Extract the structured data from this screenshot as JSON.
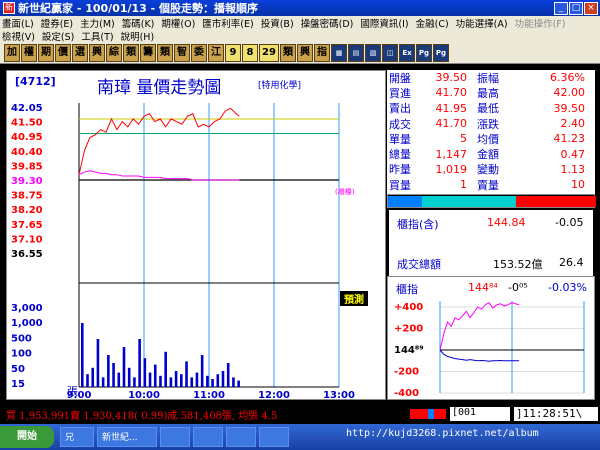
{
  "window": {
    "title": "新世紀贏家 - 100/01/13 - 個股走勢：播報順序",
    "controls": [
      "_",
      "□",
      "×"
    ]
  },
  "menu": {
    "row1": [
      "畫面(L)",
      "證券(E)",
      "主力(M)",
      "籌碼(K)",
      "期權(O)",
      "匯市利率(E)",
      "投資(B)",
      "操盤密碼(D)",
      "國際資訊(I)",
      "金融(C)",
      "功能選擇(A)",
      "功能操作(F)"
    ],
    "row2": [
      "檢視(V)",
      "設定(S)",
      "工具(T)",
      "說明(H)"
    ]
  },
  "toolbar": {
    "buttons": [
      "加",
      "權",
      "期",
      "價",
      "選",
      "興",
      "綜",
      "類",
      "籌",
      "類",
      "智",
      "委",
      "江",
      "9",
      "8",
      "29",
      "類",
      "興",
      "指"
    ]
  },
  "stock": {
    "code": "[4712]",
    "name": "南璋  量價走勢圖",
    "tag": "[特用化學]",
    "zhi_label": "(櫃檯)",
    "yumei_label": "預測",
    "zhang_label": "張"
  },
  "price_axis": [
    "42.05",
    "41.50",
    "40.95",
    "40.40",
    "39.85",
    "39.30",
    "38.75",
    "38.20",
    "37.65",
    "37.10",
    "36.55"
  ],
  "volume_axis": [
    "3,000",
    "1,000",
    "500",
    "100",
    "50",
    "15"
  ],
  "time_axis": [
    "9:00",
    "10:00",
    "11:00",
    "12:00",
    "13:00"
  ],
  "quote": {
    "rows": [
      {
        "l1": "開盤",
        "v1": "39.50",
        "c1": "#ff0000",
        "l2": "振幅",
        "v2": "6.36%",
        "c2": "#ff0000"
      },
      {
        "l1": "買進",
        "v1": "41.70",
        "c1": "#ff0000",
        "l2": "最高",
        "v2": "42.00",
        "c2": "#ff0000"
      },
      {
        "l1": "賣出",
        "v1": "41.95",
        "c1": "#ff0000",
        "l2": "最低",
        "v2": "39.50",
        "c2": "#ff0000"
      },
      {
        "l1": "成交",
        "v1": "41.70",
        "c1": "#ff0000",
        "l2": "漲跌",
        "v2": "2.40",
        "c2": "#ff0000"
      },
      {
        "l1": "單量",
        "v1": "5",
        "c1": "#ff0000",
        "l2": "均價",
        "v2": "41.23",
        "c2": "#ff0000"
      },
      {
        "l1": "總量",
        "v1": "1,147",
        "c1": "#ff0000",
        "l2": "金額",
        "v2": "0.47",
        "c2": "#ff0000"
      },
      {
        "l1": "昨量",
        "v1": "1,019",
        "c1": "#ff0000",
        "l2": "變動",
        "v2": "1.13",
        "c2": "#ff0000"
      },
      {
        "l1": "買量",
        "v1": "1",
        "c1": "#ff0000",
        "l2": "賣量",
        "v2": "10",
        "c2": "#ff0000"
      }
    ]
  },
  "index": {
    "label": "櫃指(含)",
    "value": "144.84",
    "change": "-0.05",
    "vol_label": "成交總額",
    "vol_value": "153.52億",
    "vol_change": "26.4"
  },
  "mini": {
    "label": "櫃指",
    "value": "144⁸⁴",
    "change": "-0⁰⁵",
    "pct": "-0.03%",
    "axis": [
      "+400",
      "+200",
      "144⁸⁹",
      "-200",
      "-400"
    ]
  },
  "status": {
    "summary": "買 1,953,991賣 1,930,418( 0.99)成 581,408張, 均張 4.5",
    "code": "[001",
    "clock": "]11:28:51\\"
  },
  "taskbar": {
    "start": "開始",
    "tasks": [
      "兄",
      "新世紀...",
      "",
      "",
      "",
      "",
      ""
    ],
    "url": "http://kujd3268.pixnet.net/album"
  },
  "colors": {
    "price_line": "#ff0000",
    "avg_line": "#ff00ff",
    "volume": "#0000cc",
    "grid_v": "#3399ff",
    "ref_line": "#00aa66"
  },
  "chart_data": [
    {
      "type": "line",
      "x_time": [
        "9:00",
        "9:05",
        "9:10",
        "9:15",
        "9:20",
        "9:25",
        "9:30",
        "9:35",
        "9:40",
        "9:45",
        "9:50",
        "9:55",
        "10:00",
        "10:05",
        "10:10",
        "10:15",
        "10:20",
        "10:25",
        "10:30",
        "10:35",
        "10:40",
        "10:45",
        "10:50",
        "10:55",
        "11:00",
        "11:05",
        "11:10",
        "11:15",
        "11:20",
        "11:25",
        "11:28"
      ],
      "price": [
        39.5,
        40.4,
        40.9,
        41.0,
        41.2,
        41.1,
        41.6,
        41.2,
        41.5,
        41.3,
        41.6,
        41.4,
        41.7,
        41.8,
        41.5,
        41.6,
        41.3,
        41.6,
        41.5,
        41.4,
        41.7,
        41.8,
        41.3,
        41.4,
        41.3,
        41.5,
        41.6,
        41.9,
        42.0,
        41.8,
        41.7
      ],
      "avg_price": [
        39.5,
        39.6,
        39.65,
        39.6,
        39.55,
        39.55,
        39.5,
        39.5,
        39.45,
        39.45,
        39.45,
        39.45,
        39.4,
        39.4,
        39.4,
        39.4,
        39.35,
        39.35,
        39.35,
        39.35,
        39.35,
        39.3,
        39.3,
        39.3,
        39.3,
        39.3,
        39.3,
        39.3,
        39.3,
        39.3,
        39.3
      ],
      "ylim": [
        36.55,
        42.05
      ],
      "ref_price": 39.3
    },
    {
      "type": "bar",
      "volume": [
        400,
        80,
        120,
        300,
        60,
        200,
        150,
        90,
        250,
        120,
        60,
        300,
        180,
        90,
        140,
        70,
        220,
        60,
        100,
        80,
        160,
        60,
        90,
        200,
        70,
        50,
        80,
        100,
        150,
        60,
        40
      ]
    },
    {
      "type": "line",
      "index_curve": [
        0,
        150,
        260,
        220,
        300,
        280,
        320,
        360,
        300,
        350,
        400,
        380,
        420,
        440,
        390,
        420,
        430,
        410,
        420,
        440,
        430,
        420
      ],
      "index_zero_line": [
        0,
        -40,
        -60,
        -70,
        -80,
        -85,
        -90,
        -95,
        -90,
        -95,
        -100,
        -98,
        -100,
        -105,
        -100,
        -100,
        -98,
        -100,
        -100,
        -100,
        -100,
        -100
      ],
      "ylim": [
        -400,
        400
      ]
    }
  ]
}
